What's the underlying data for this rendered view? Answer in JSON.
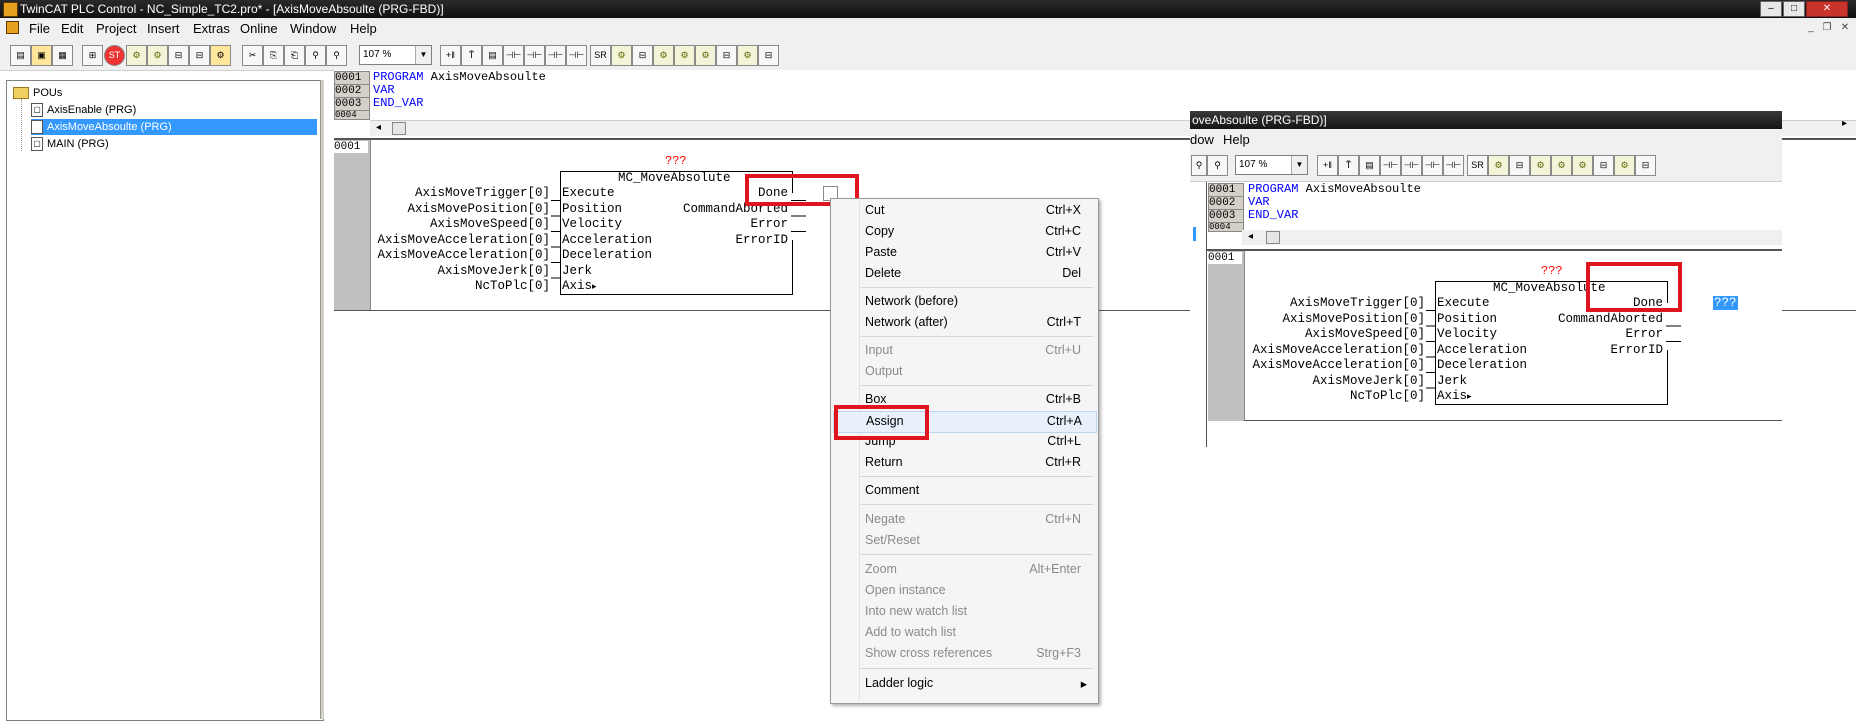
{
  "window": {
    "title": "TwinCAT PLC Control - NC_Simple_TC2.pro* - [AxisMoveAbsoulte (PRG-FBD)]",
    "min": "–",
    "max": "□",
    "close": "✕",
    "mdi_min": "_",
    "mdi_restore": "❐",
    "mdi_close": "✕"
  },
  "menubar": [
    "File",
    "Edit",
    "Project",
    "Insert",
    "Extras",
    "Online",
    "Window",
    "Help"
  ],
  "toolbar": {
    "zoom_value": "107 %",
    "zoom_arrow": "▼",
    "buttons_a": [
      "▤",
      "▣",
      "▦",
      "⊞",
      "ST",
      "⚙",
      "⚙",
      "⊟",
      "⊟",
      "⚙"
    ],
    "buttons_b": [
      "✂",
      "⎘",
      "⎗",
      "⚲",
      "⚲"
    ],
    "buttons_c": [
      "+ǁ",
      "T̄",
      "▤",
      "⊣⊢",
      "⊣⊢",
      "⊣⊢",
      "⊣⊢",
      "SR",
      "⚙",
      "⊟",
      "⚙",
      "⚙",
      "⚙",
      "⊟",
      "⚙",
      "⊟"
    ]
  },
  "tree": {
    "root": "POUs",
    "items": [
      "AxisEnable (PRG)",
      "AxisMoveAbsoulte (PRG)",
      "MAIN (PRG)"
    ],
    "selected_index": 1,
    "item_icon": "▢"
  },
  "decl": {
    "line_numbers": [
      "0001",
      "0002",
      "0003",
      "0004"
    ],
    "lines": [
      {
        "kw": "PROGRAM",
        "rest": " AxisMoveAbsoulte"
      },
      {
        "kw": "VAR",
        "rest": ""
      },
      {
        "kw": "END_VAR",
        "rest": ""
      }
    ],
    "scroll_left": "◂"
  },
  "network": {
    "number": "0001",
    "instance": "???",
    "fb_type": "MC_MoveAbsolute",
    "inputs_vars": [
      "AxisMoveTrigger[0]",
      "AxisMovePosition[0]",
      "AxisMoveSpeed[0]",
      "AxisMoveAcceleration[0]",
      "AxisMoveAcceleration[0]",
      "AxisMoveJerk[0]",
      "NcToPlc[0]"
    ],
    "inputs_pins": [
      "Execute",
      "Position",
      "Velocity",
      "Acceleration",
      "Deceleration",
      "Jerk",
      "Axis"
    ],
    "outputs_pins": [
      "Done",
      "CommandAborted",
      "Error",
      "ErrorID"
    ],
    "axis_arrow": "▸",
    "assign_value": "???"
  },
  "inset": {
    "title": "oveAbsoulte (PRG-FBD)]",
    "menu": [
      "dow",
      "Help"
    ],
    "zoom_value": "107 %",
    "right_arrow": "▸"
  },
  "context_menu": {
    "items": [
      {
        "label": "Cut",
        "shortcut": "Ctrl+X",
        "disabled": false
      },
      {
        "label": "Copy",
        "shortcut": "Ctrl+C",
        "disabled": false
      },
      {
        "label": "Paste",
        "shortcut": "Ctrl+V",
        "disabled": false
      },
      {
        "label": "Delete",
        "shortcut": "Del",
        "disabled": false
      },
      {
        "label": "Network (before)",
        "shortcut": "",
        "disabled": false
      },
      {
        "label": "Network (after)",
        "shortcut": "Ctrl+T",
        "disabled": false
      },
      {
        "label": "Input",
        "shortcut": "Ctrl+U",
        "disabled": true
      },
      {
        "label": "Output",
        "shortcut": "",
        "disabled": true
      },
      {
        "label": "Box",
        "shortcut": "Ctrl+B",
        "disabled": false
      },
      {
        "label": "Assign",
        "shortcut": "Ctrl+A",
        "disabled": false
      },
      {
        "label": "Jump",
        "shortcut": "Ctrl+L",
        "disabled": false
      },
      {
        "label": "Return",
        "shortcut": "Ctrl+R",
        "disabled": false
      },
      {
        "label": "Comment",
        "shortcut": "",
        "disabled": false
      },
      {
        "label": "Negate",
        "shortcut": "Ctrl+N",
        "disabled": true
      },
      {
        "label": "Set/Reset",
        "shortcut": "",
        "disabled": true
      },
      {
        "label": "Zoom",
        "shortcut": "Alt+Enter",
        "disabled": true
      },
      {
        "label": "Open instance",
        "shortcut": "",
        "disabled": true
      },
      {
        "label": "Into new watch list",
        "shortcut": "",
        "disabled": true
      },
      {
        "label": "Add to watch list",
        "shortcut": "",
        "disabled": true
      },
      {
        "label": "Show cross references",
        "shortcut": "Strg+F3",
        "disabled": true
      },
      {
        "label": "Ladder logic",
        "shortcut": "▸",
        "disabled": false
      }
    ],
    "highlighted_index": 9
  }
}
